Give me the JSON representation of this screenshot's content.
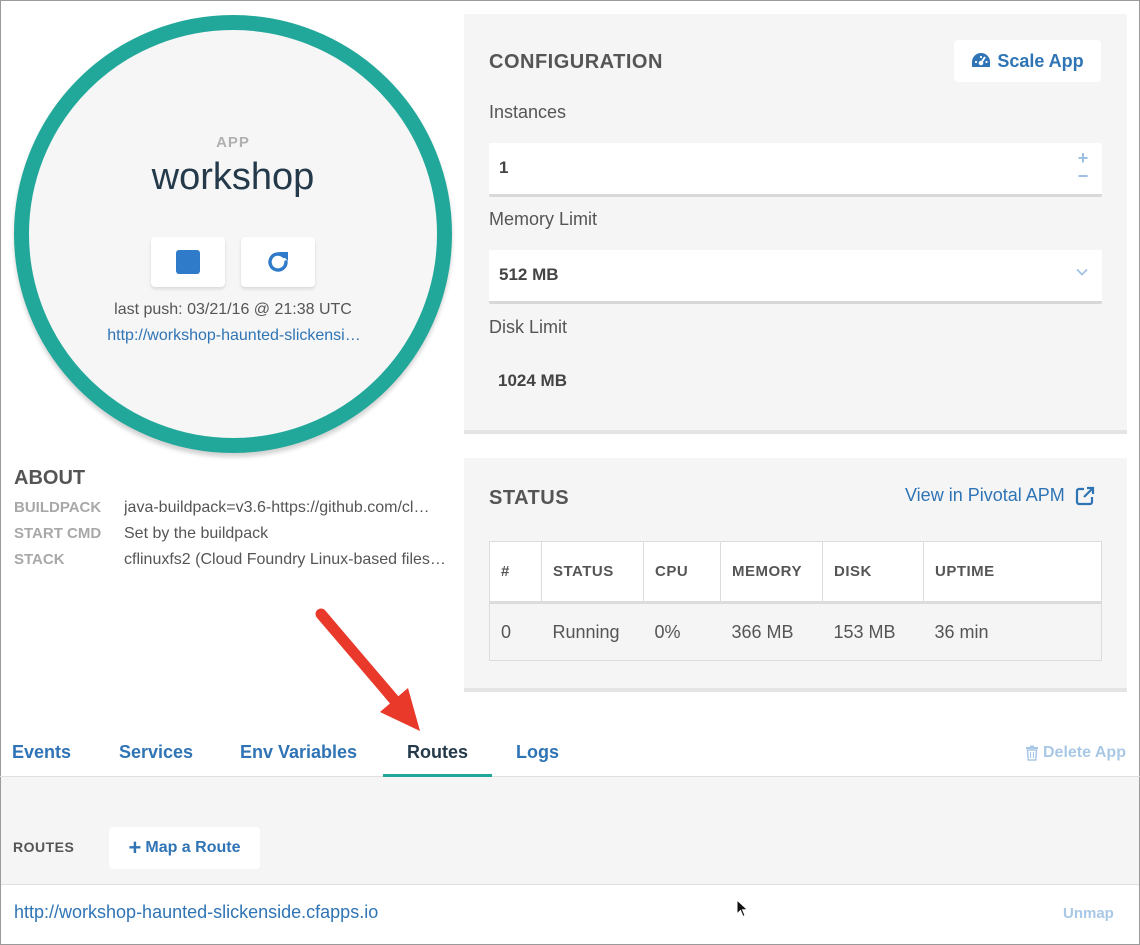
{
  "app": {
    "label": "APP",
    "name": "workshop",
    "last_push": "last push: 03/21/16 @ 21:38 UTC",
    "url": "http://workshop-haunted-slickensi…",
    "stop_icon": "stop-icon",
    "restart_icon": "restart-icon",
    "accent_color": "#22a89a"
  },
  "about": {
    "title": "ABOUT",
    "rows": [
      {
        "key": "BUILDPACK",
        "value": "java-buildpack=v3.6-https://github.com/cl…"
      },
      {
        "key": "START CMD",
        "value": "Set by the buildpack"
      },
      {
        "key": "STACK",
        "value": "cflinuxfs2 (Cloud Foundry Linux-based files…"
      }
    ]
  },
  "configuration": {
    "title": "CONFIGURATION",
    "scale_button": "Scale App",
    "scale_icon": "dashboard-icon",
    "instances_label": "Instances",
    "instances_value": "1",
    "stepper_plus": "+",
    "stepper_minus": "−",
    "memory_label": "Memory Limit",
    "memory_value": "512 MB",
    "disk_label": "Disk Limit",
    "disk_value": "1024 MB"
  },
  "status": {
    "title": "STATUS",
    "apm_link": "View in Pivotal APM",
    "columns": [
      "#",
      "STATUS",
      "CPU",
      "MEMORY",
      "DISK",
      "UPTIME"
    ],
    "rows": [
      [
        "0",
        "Running",
        "0%",
        "366 MB",
        "153 MB",
        "36 min"
      ]
    ]
  },
  "tabs": {
    "items": [
      "Events",
      "Services",
      "Env Variables",
      "Routes",
      "Logs"
    ],
    "active": "Routes",
    "delete_app": "Delete App"
  },
  "routes": {
    "label": "ROUTES",
    "map_button": "Map a Route",
    "map_plus": "+",
    "items": [
      {
        "url": "http://workshop-haunted-slickenside.cfapps.io",
        "action": "Unmap"
      }
    ]
  },
  "colors": {
    "link": "#2f74b5",
    "panel_bg": "#f5f5f5",
    "arrow": "#e8392a"
  }
}
